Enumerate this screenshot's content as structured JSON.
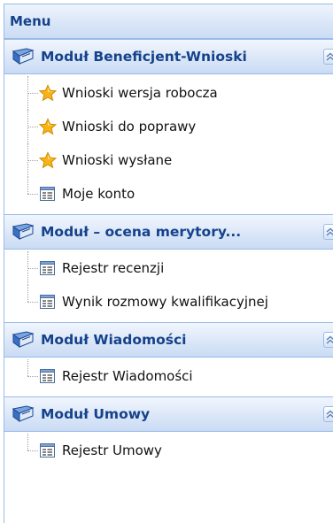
{
  "menu": {
    "title": "Menu"
  },
  "modules": [
    {
      "title": "Moduł Beneficjent-Wnioski",
      "items": [
        {
          "label": "Wnioski wersja robocza",
          "icon": "star-icon"
        },
        {
          "label": "Wnioski do poprawy",
          "icon": "star-icon"
        },
        {
          "label": "Wnioski wysłane",
          "icon": "star-icon"
        },
        {
          "label": "Moje konto",
          "icon": "list-icon"
        }
      ]
    },
    {
      "title": "Moduł – ocena merytory...",
      "items": [
        {
          "label": "Rejestr recenzji",
          "icon": "list-icon"
        },
        {
          "label": "Wynik rozmowy kwalifikacyjnej",
          "icon": "list-icon"
        }
      ]
    },
    {
      "title": "Moduł Wiadomości",
      "items": [
        {
          "label": "Rejestr Wiadomości",
          "icon": "list-icon"
        }
      ]
    },
    {
      "title": "Moduł Umowy",
      "items": [
        {
          "label": "Rejestr Umowy",
          "icon": "list-icon"
        }
      ]
    }
  ],
  "colors": {
    "header_text": "#15428b",
    "border": "#99bbe8",
    "star": "#f5b400"
  }
}
